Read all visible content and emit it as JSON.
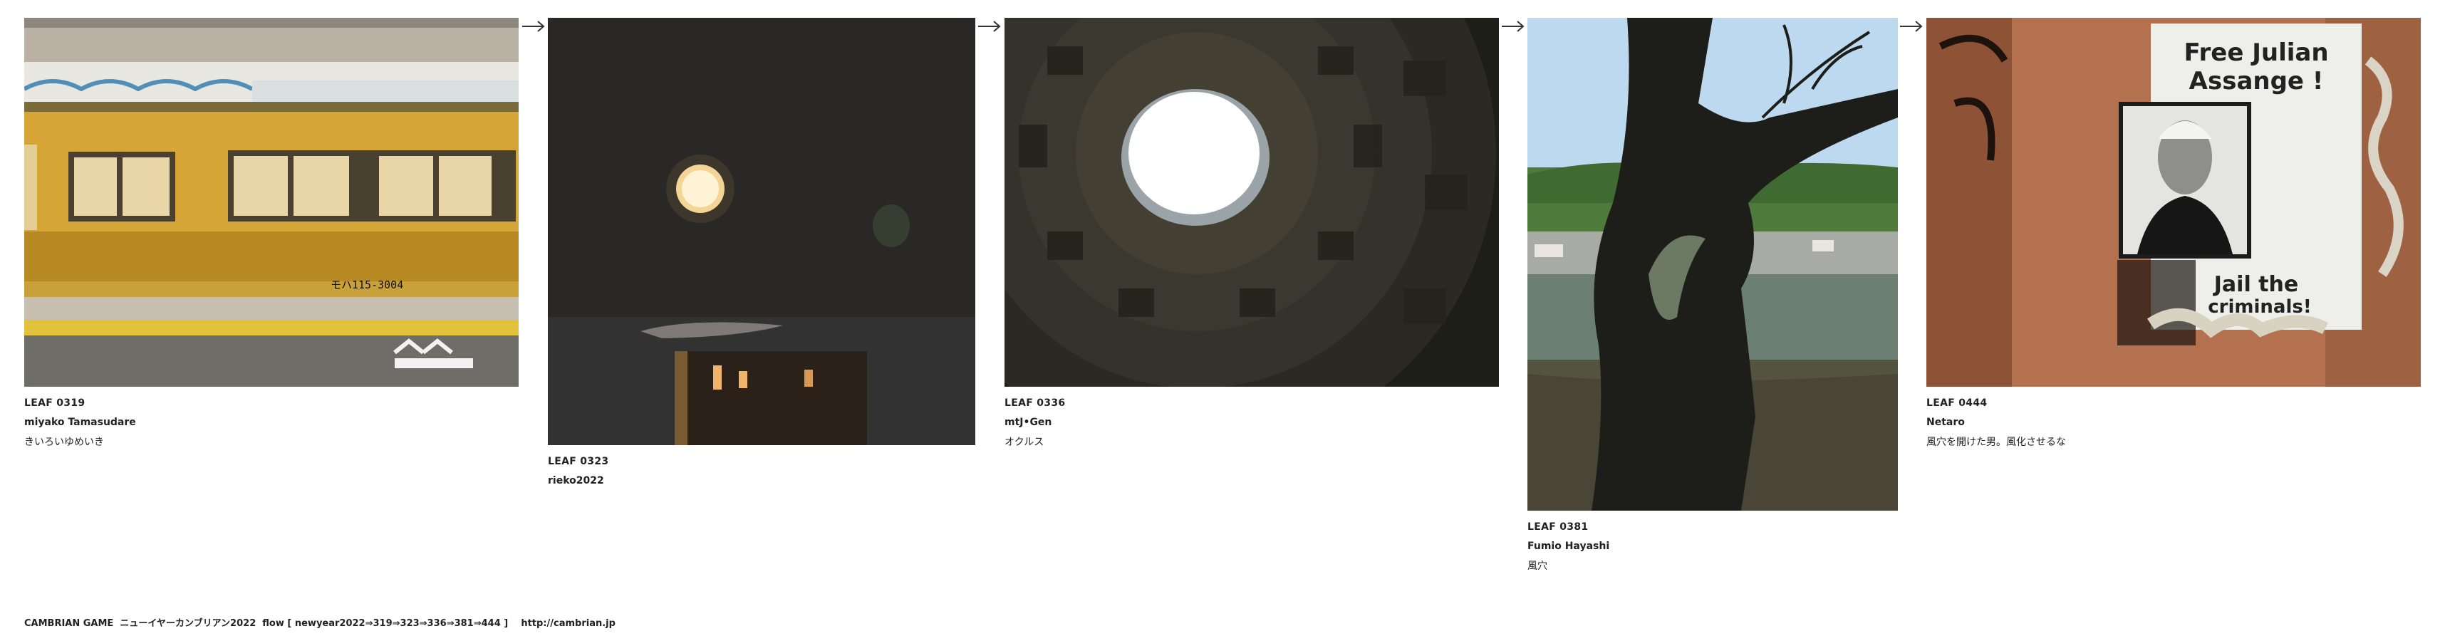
{
  "leaves": [
    {
      "title": "LEAF 0319",
      "author": "miyako Tamasudare",
      "note": "きいろいゆめいき",
      "train_number": "モハ115-3004"
    },
    {
      "title": "LEAF 0323",
      "author": "rieko2022",
      "note": ""
    },
    {
      "title": "LEAF 0336",
      "author": "mtJ•Gen",
      "note": "オクルス"
    },
    {
      "title": "LEAF 0381",
      "author": "Fumio Hayashi",
      "note": "風穴"
    },
    {
      "title": "LEAF 0444",
      "author": "Netaro",
      "note": "風穴を開けた男。風化させるな",
      "poster": {
        "line1": "Free Julian",
        "line2": "Assange !",
        "line3": "Jail the",
        "line4": "criminals!"
      }
    }
  ],
  "arrow_icon": "right-arrow-icon",
  "footer": {
    "text": "CAMBRIAN GAME  ニューイヤーカンブリアン2022  flow [ newyear2022⇒319⇒323⇒336⇒381⇒444 ]    http://cambrian.jp"
  }
}
